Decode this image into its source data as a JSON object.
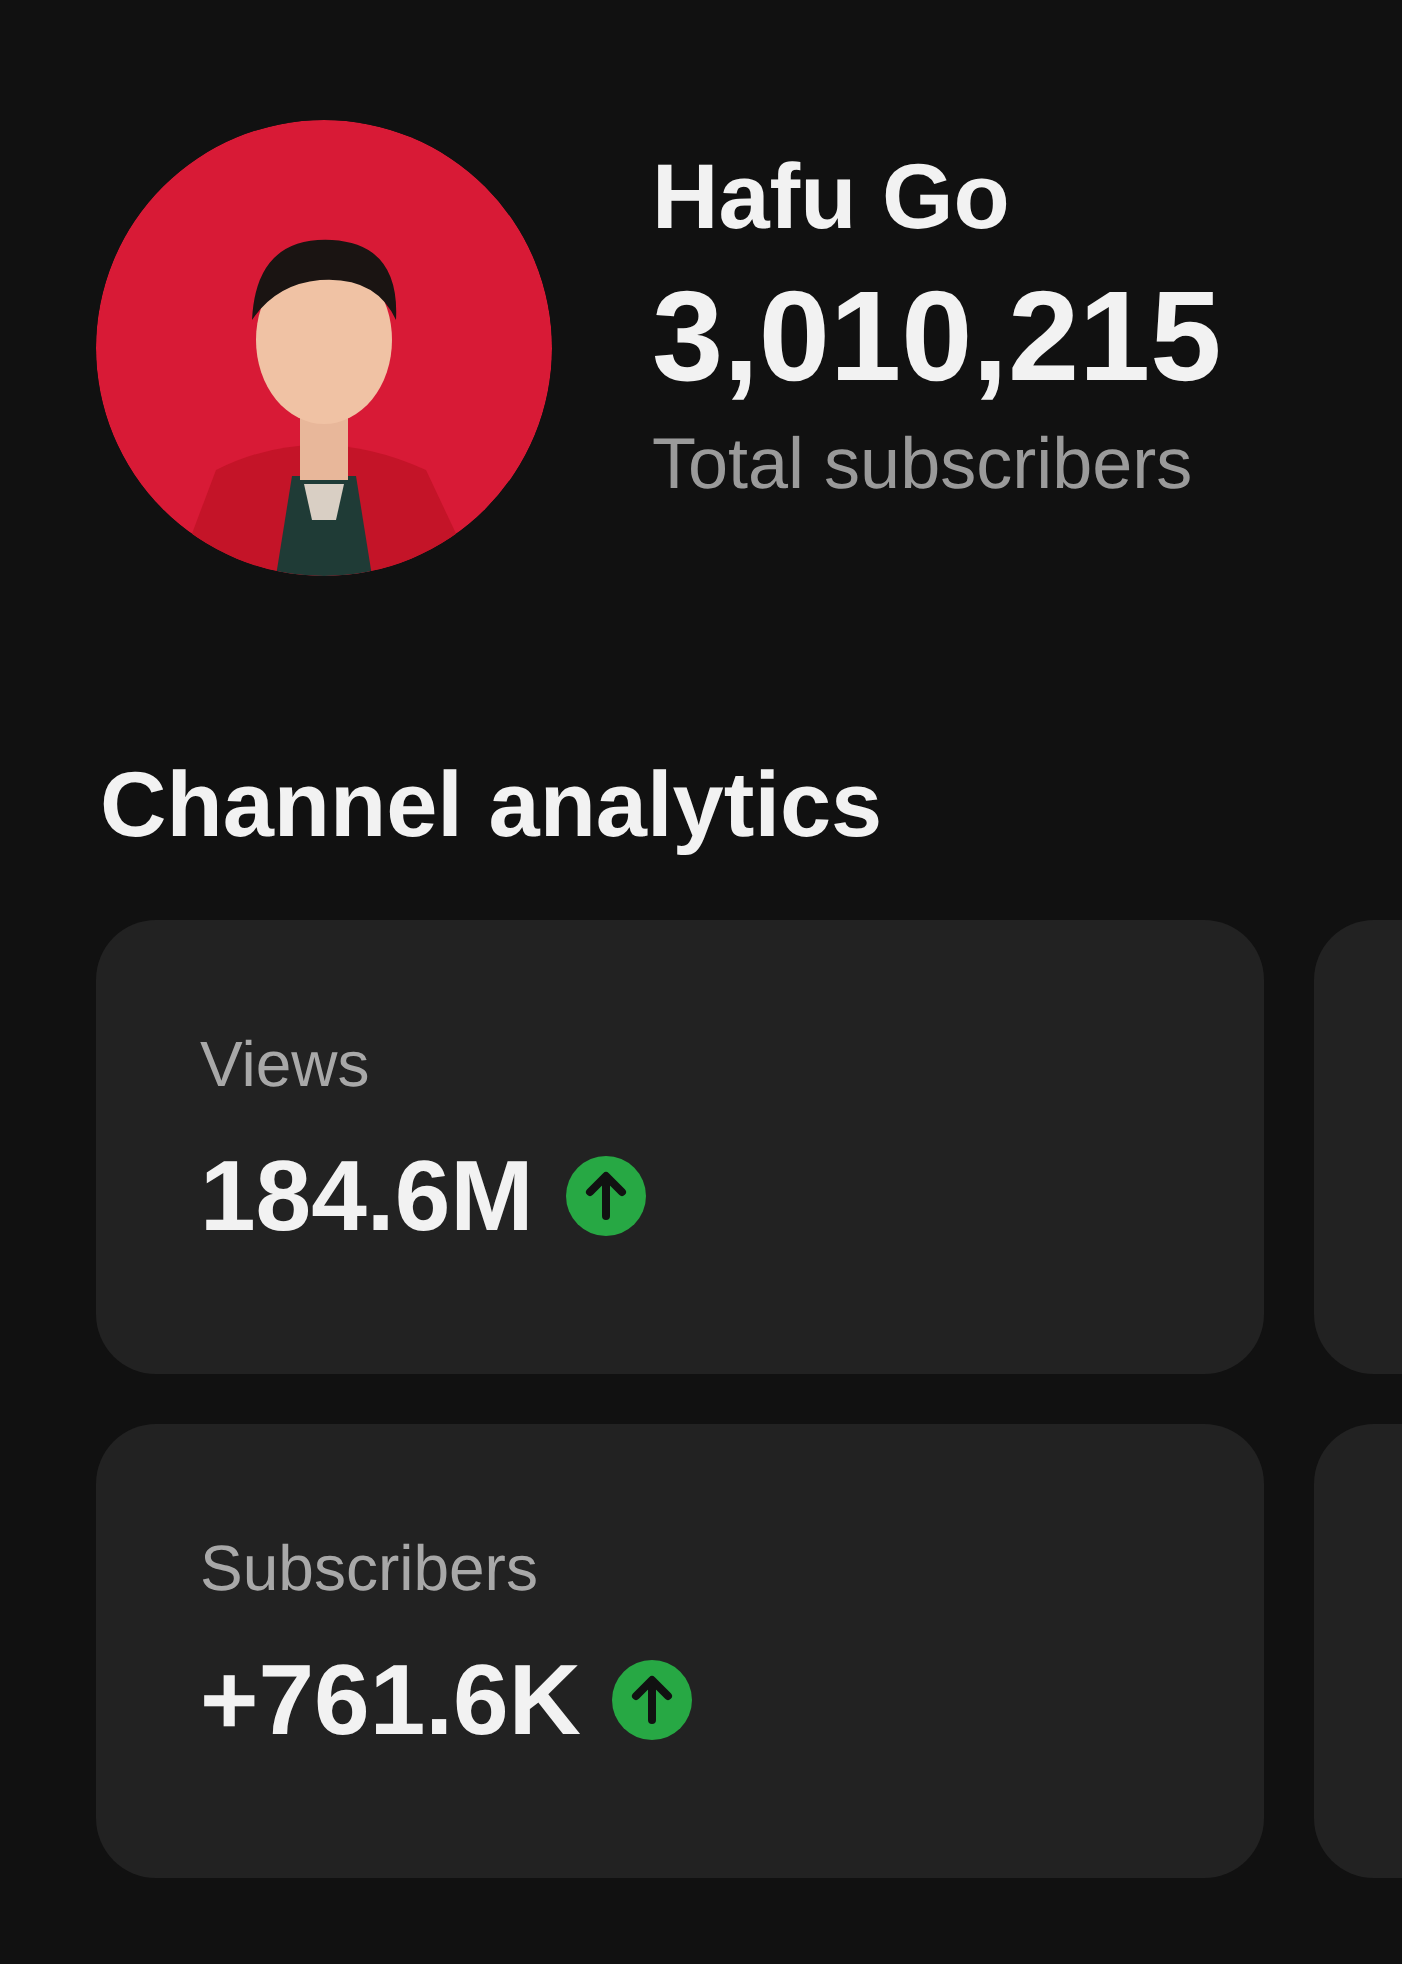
{
  "profile": {
    "name": "Hafu Go",
    "subscriber_count": "3,010,215",
    "subscriber_label": "Total subscribers"
  },
  "section_title": "Channel analytics",
  "card_rows": [
    {
      "cards": [
        {
          "kind": "stat",
          "label": "Views",
          "value": "184.6M",
          "trending_up": true
        },
        {
          "kind": "cut_off"
        }
      ]
    },
    {
      "cards": [
        {
          "kind": "stat",
          "label": "Subscribers",
          "value": "+761.6K",
          "trending_up": true
        },
        {
          "kind": "cut_off"
        }
      ]
    }
  ]
}
